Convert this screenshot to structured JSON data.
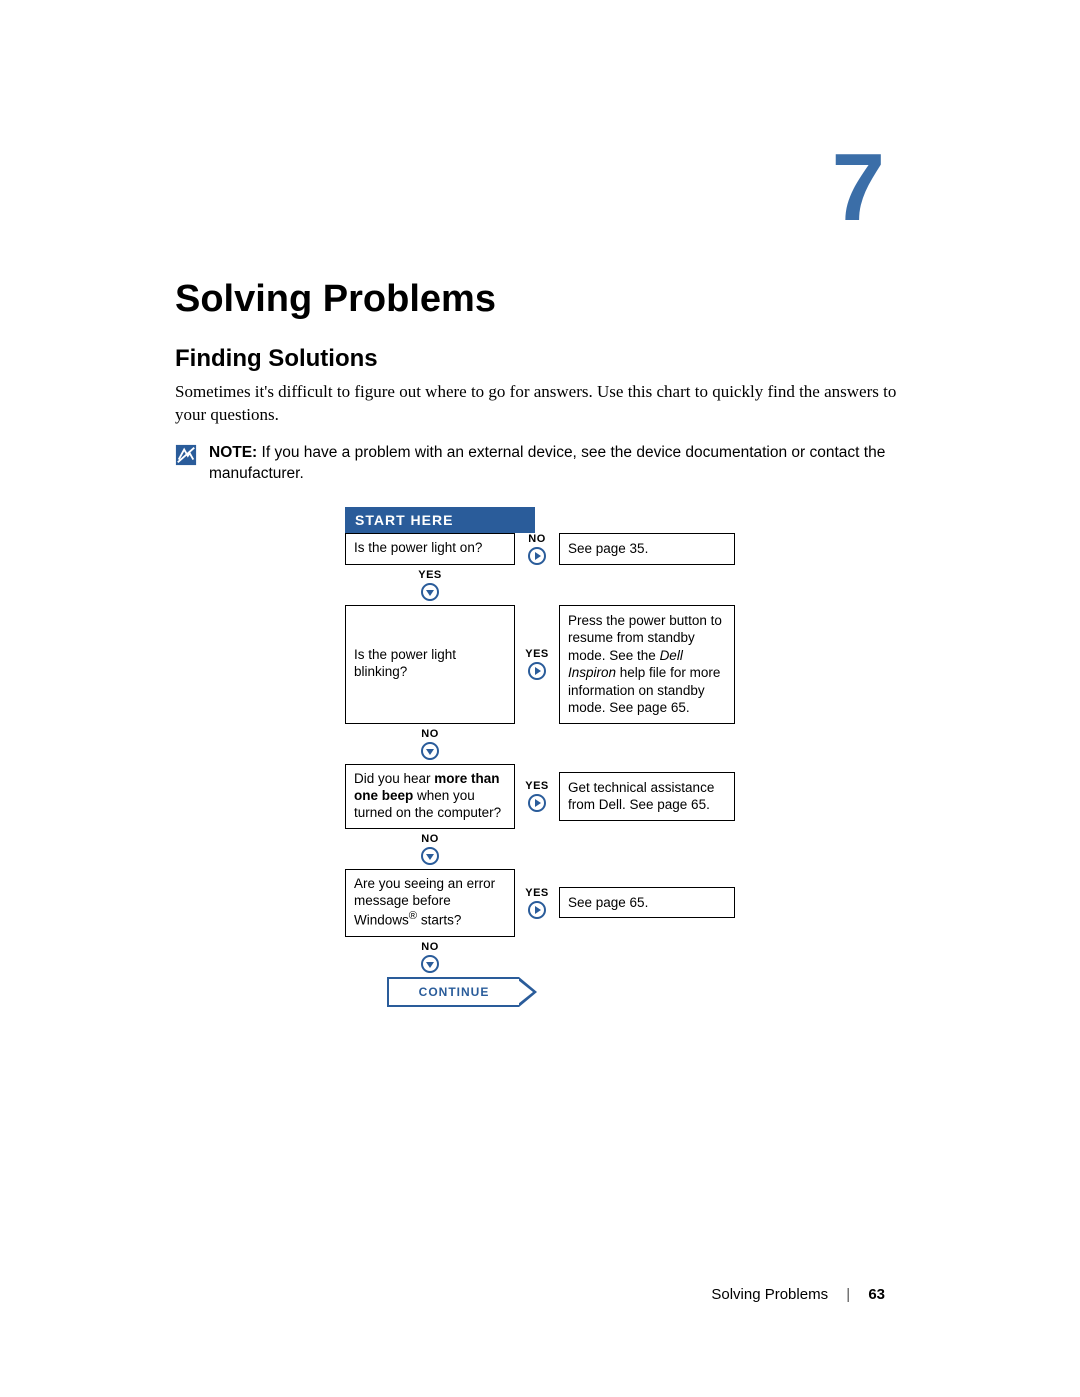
{
  "chapter": {
    "number": "7",
    "title": "Solving Problems"
  },
  "section": {
    "heading": "Finding Solutions",
    "intro": "Sometimes it's difficult to figure out where to go for answers. Use this chart to quickly find the answers to your questions."
  },
  "note": {
    "label": "NOTE:",
    "text": " If you have a problem with an external device, see the device documentation or contact the manufacturer."
  },
  "flow": {
    "start_label": "START HERE",
    "yes": "YES",
    "no": "NO",
    "continue_label": "CONTINUE",
    "steps": [
      {
        "question": "Is the power light on?",
        "right_label": "NO",
        "answer_plain": "See page 35.",
        "down_label": "YES"
      },
      {
        "question": "Is the power light blinking?",
        "right_label": "YES",
        "answer_pre": "Press the power button to resume from standby mode. See the ",
        "answer_italic": "Dell Inspiron",
        "answer_post": " help file for more information on standby mode. See page 65.",
        "down_label": "NO"
      },
      {
        "question_pre": "Did you hear ",
        "question_bold1": "more than one beep",
        "question_post": " when you turned on the computer?",
        "right_label": "YES",
        "answer_plain": "Get technical assistance from Dell. See page 65.",
        "down_label": "NO"
      },
      {
        "question_pre2": "Are you seeing an error message before Windows",
        "question_sup": "®",
        "question_post2": " starts?",
        "right_label": "YES",
        "answer_plain": "See page 65.",
        "down_label": "NO"
      }
    ]
  },
  "footer": {
    "section": "Solving Problems",
    "page": "63"
  }
}
